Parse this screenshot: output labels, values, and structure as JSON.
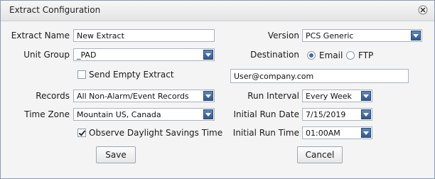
{
  "dialog": {
    "title": "Extract Configuration",
    "close_icon": "close-circle-icon"
  },
  "form": {
    "extract_name": {
      "label": "Extract Name",
      "value": "New Extract"
    },
    "unit_group": {
      "label": "Unit Group",
      "value": "_PAD"
    },
    "send_empty": {
      "label": "Send Empty Extract",
      "checked": false
    },
    "records": {
      "label": "Records",
      "value": "All Non-Alarm/Event Records"
    },
    "time_zone": {
      "label": "Time Zone",
      "value": "Mountain US, Canada"
    },
    "dst": {
      "label": "Observe Daylight Savings Time",
      "checked": true
    },
    "version": {
      "label": "Version",
      "value": "PCS Generic"
    },
    "destination": {
      "label": "Destination",
      "email_label": "Email",
      "ftp_label": "FTP",
      "selected": "Email"
    },
    "email_address": {
      "value": "User@company.com"
    },
    "run_interval": {
      "label": "Run Interval",
      "value": "Every Week"
    },
    "initial_run_date": {
      "label": "Initial Run Date",
      "value": "7/15/2019"
    },
    "initial_run_time": {
      "label": "Initial Run Time",
      "value": "01:00AM"
    }
  },
  "buttons": {
    "save": "Save",
    "cancel": "Cancel"
  },
  "colors": {
    "dropdown_arrow": "#3b6ea5",
    "border": "#a9b3c0"
  }
}
